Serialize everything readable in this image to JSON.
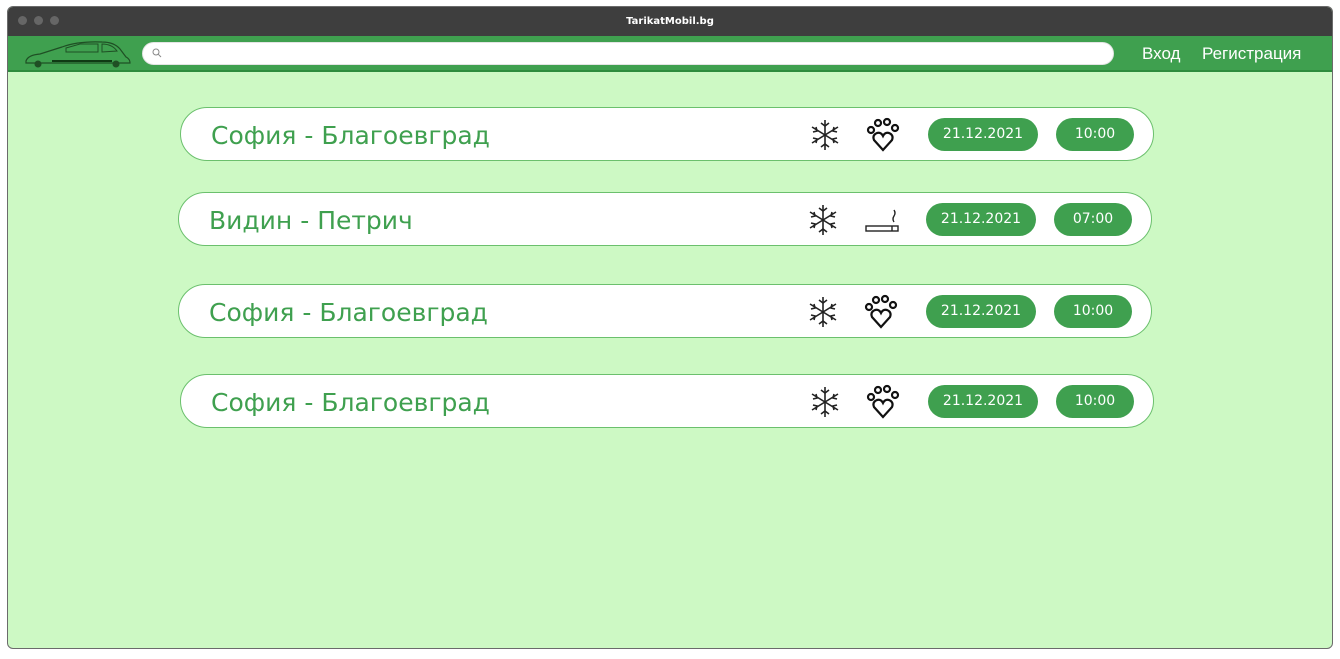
{
  "window": {
    "title": "TarikatMobil.bg"
  },
  "header": {
    "logo_icon": "car-icon",
    "search": {
      "placeholder": "",
      "value": "",
      "icon": "search-icon"
    },
    "login_label": "Вход",
    "register_label": "Регистрация"
  },
  "colors": {
    "background": "#cdf9c4",
    "accent": "#3fa04f",
    "titlebar": "#3e3e3e"
  },
  "trips": [
    {
      "route": "София - Благоевград",
      "features": [
        "snowflake-icon",
        "paw-heart-icon"
      ],
      "date": "21.12.2021",
      "time": "10:00"
    },
    {
      "route": "Видин - Петрич",
      "features": [
        "snowflake-icon",
        "cigarette-icon"
      ],
      "date": "21.12.2021",
      "time": "07:00"
    },
    {
      "route": "София - Благоевград",
      "features": [
        "snowflake-icon",
        "paw-heart-icon"
      ],
      "date": "21.12.2021",
      "time": "10:00"
    },
    {
      "route": "София - Благоевград",
      "features": [
        "snowflake-icon",
        "paw-heart-icon"
      ],
      "date": "21.12.2021",
      "time": "10:00"
    }
  ]
}
